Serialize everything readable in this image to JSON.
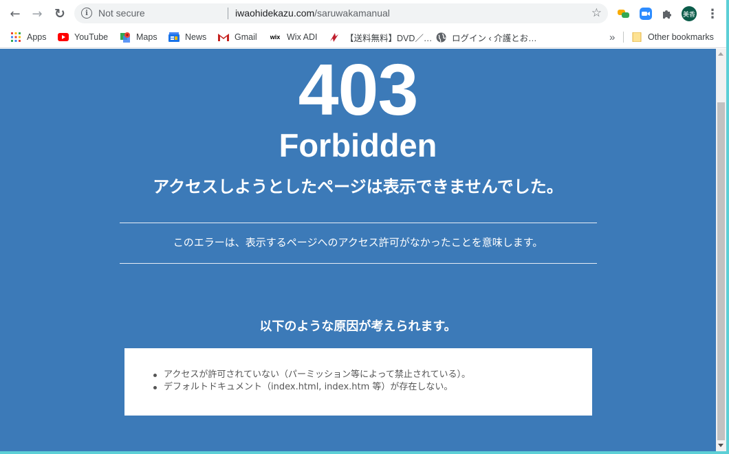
{
  "toolbar": {
    "back_glyph": "←",
    "forward_glyph": "→",
    "reload_glyph": "↻",
    "security_label": "Not secure",
    "url_host": "iwaohidekazu.com",
    "url_path": "/saruwakamanual",
    "profile_initials": "美香",
    "menu_glyph": "⋮"
  },
  "bookmarks": {
    "items": [
      {
        "label": "Apps"
      },
      {
        "label": "YouTube"
      },
      {
        "label": "Maps"
      },
      {
        "label": "News"
      },
      {
        "label": "Gmail"
      },
      {
        "label": "Wix ADI",
        "icon_text": "wix"
      },
      {
        "label": "【送料無料】DVD／…"
      },
      {
        "label": "ログイン ‹ 介護とお…"
      }
    ],
    "overflow_glyph": "»",
    "other_label": "Other bookmarks"
  },
  "page": {
    "code": "403",
    "status": "Forbidden",
    "headline": "アクセスしようとしたページは表示できませんでした。",
    "description": "このエラーは、表示するページへのアクセス許可がなかったことを意味します。",
    "causes_title": "以下のような原因が考えられます。",
    "causes": [
      "アクセスが許可されていない（パーミッション等によって禁止されている）。",
      "デフォルトドキュメント（index.html, index.htm 等）が存在しない。"
    ]
  },
  "colors": {
    "page_background": "#3c7ab8",
    "window_border": "#5ccfd6",
    "text_on_blue": "#ffffff",
    "list_text": "#555555"
  }
}
